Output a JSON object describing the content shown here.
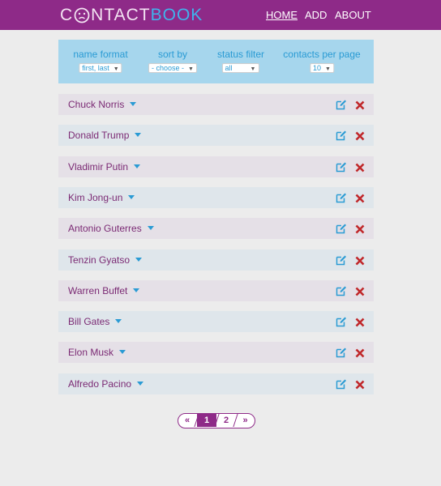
{
  "app": {
    "logo_prefix": "C",
    "logo_middle": "NTACT",
    "logo_suffix": "BOOK"
  },
  "nav": {
    "home": "HOME",
    "add": "ADD",
    "about": "ABOUT"
  },
  "filters": {
    "name_format": {
      "label": "name format",
      "value": "first, last"
    },
    "sort_by": {
      "label": "sort by",
      "value": "- choose -"
    },
    "status_filter": {
      "label": "status filter",
      "value": "all"
    },
    "contacts_per_page": {
      "label": "contacts per page",
      "value": "10"
    }
  },
  "contacts": [
    {
      "name": "Chuck Norris"
    },
    {
      "name": "Donald Trump"
    },
    {
      "name": "Vladimir Putin"
    },
    {
      "name": "Kim Jong-un"
    },
    {
      "name": "Antonio Guterres"
    },
    {
      "name": "Tenzin Gyatso"
    },
    {
      "name": "Warren Buffet"
    },
    {
      "name": "Bill Gates"
    },
    {
      "name": "Elon Musk"
    },
    {
      "name": "Alfredo Pacino"
    }
  ],
  "pagination": {
    "prev": "«",
    "pages": [
      "1",
      "2"
    ],
    "current": "1",
    "next": "»"
  },
  "icons": {
    "edit": "edit-icon",
    "delete": "delete-icon",
    "caret": "caret-down-icon",
    "logo": "smiley-face-icon"
  },
  "colors": {
    "header": "#8e2a88",
    "accent": "#2a9bd4",
    "panel": "#a6d6ed",
    "delete": "#c0282b",
    "name": "#7b2a74"
  }
}
